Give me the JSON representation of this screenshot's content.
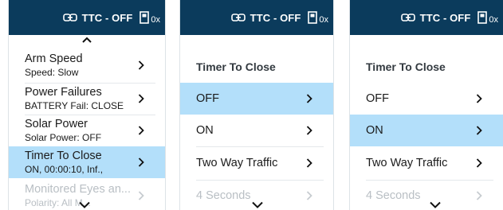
{
  "colors": {
    "header_bg": "#0b3b5c",
    "selected_bg": "#b3dffa",
    "text": "#1a1a1a",
    "disabled_text": "#b9bfc4"
  },
  "header": {
    "status": "TTC - OFF",
    "count": "0x",
    "link_icon": "link-icon",
    "battery_icon": "battery-icon"
  },
  "panel1": {
    "scroll_up_icon": "chevron-up-icon",
    "items": [
      {
        "title": "Arm Speed",
        "sub": "Speed: Slow"
      },
      {
        "title": "Power Failures",
        "sub": "BATTERY Fail: CLOSE"
      },
      {
        "title": "Solar Power",
        "sub": "Solar Power: OFF"
      },
      {
        "title": "Timer To Close",
        "sub": "ON, 00:00:10, Inf.,"
      },
      {
        "title": "Monitored Eyes an...",
        "sub": "Polarity: All M..."
      }
    ],
    "scroll_down_icon": "chevron-down-icon"
  },
  "panel2": {
    "title": "Timer To Close",
    "options": [
      "OFF",
      "ON",
      "Two Way Traffic",
      "4 Seconds"
    ],
    "selected": "OFF"
  },
  "panel3": {
    "title": "Timer To Close",
    "options": [
      "OFF",
      "ON",
      "Two Way Traffic",
      "4 Seconds"
    ],
    "selected": "ON"
  }
}
